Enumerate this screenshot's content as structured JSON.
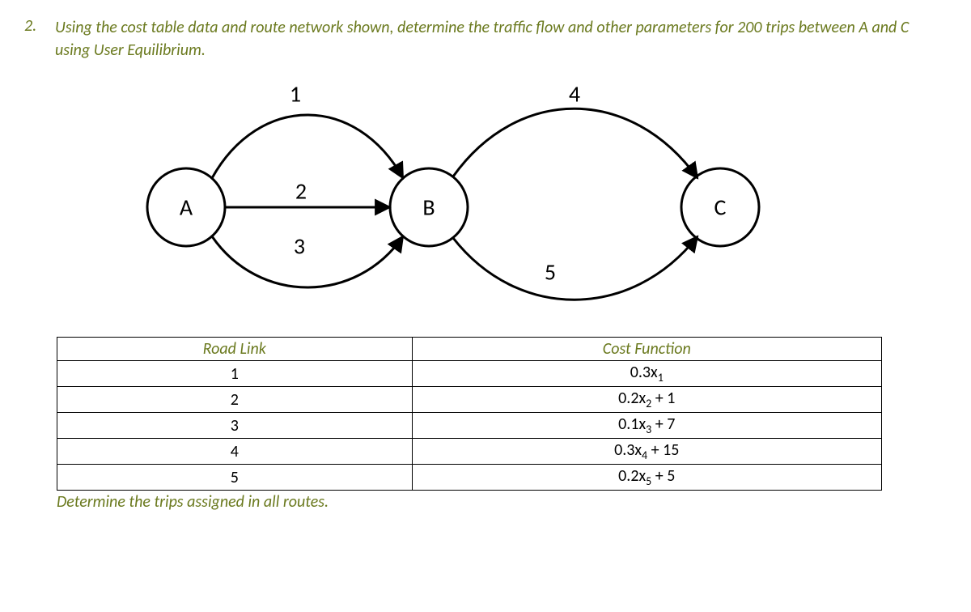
{
  "problem": {
    "number": "2.",
    "text": "Using the cost table data and route network shown, determine the traffic flow and other parameters for 200 trips between A and C using User Equilibrium."
  },
  "diagram": {
    "nodes": {
      "A": "A",
      "B": "B",
      "C": "C"
    },
    "links": {
      "l1": "1",
      "l2": "2",
      "l3": "3",
      "l4": "4",
      "l5": "5"
    }
  },
  "table": {
    "headers": {
      "col1": "Road Link",
      "col2": "Cost Function"
    },
    "rows": [
      {
        "link": "1",
        "cost_html": "0.3x<span class='sub'>1</span>"
      },
      {
        "link": "2",
        "cost_html": "0.2x<span class='sub'>2</span> + 1"
      },
      {
        "link": "3",
        "cost_html": "0.1x<span class='sub'>3</span> + 7"
      },
      {
        "link": "4",
        "cost_html": "0.3x<span class='sub'>4</span> + 15"
      },
      {
        "link": "5",
        "cost_html": "0.2x<span class='sub'>5</span> + 5"
      }
    ]
  },
  "post_text": "Determine the trips assigned in all routes.",
  "chart_data": {
    "type": "diagram",
    "description": "Route network with 3 nodes (A, B, C) and 5 directed links",
    "nodes": [
      "A",
      "B",
      "C"
    ],
    "edges": [
      {
        "id": 1,
        "from": "A",
        "to": "B",
        "curve": "upper",
        "cost": "0.3*x1"
      },
      {
        "id": 2,
        "from": "A",
        "to": "B",
        "curve": "straight",
        "cost": "0.2*x2 + 1"
      },
      {
        "id": 3,
        "from": "A",
        "to": "B",
        "curve": "lower",
        "cost": "0.1*x3 + 7"
      },
      {
        "id": 4,
        "from": "B",
        "to": "C",
        "curve": "upper",
        "cost": "0.3*x4 + 15"
      },
      {
        "id": 5,
        "from": "B",
        "to": "C",
        "curve": "lower",
        "cost": "0.2*x5 + 5"
      }
    ],
    "trips": 200,
    "origin": "A",
    "destination": "C",
    "assignment_method": "User Equilibrium"
  }
}
